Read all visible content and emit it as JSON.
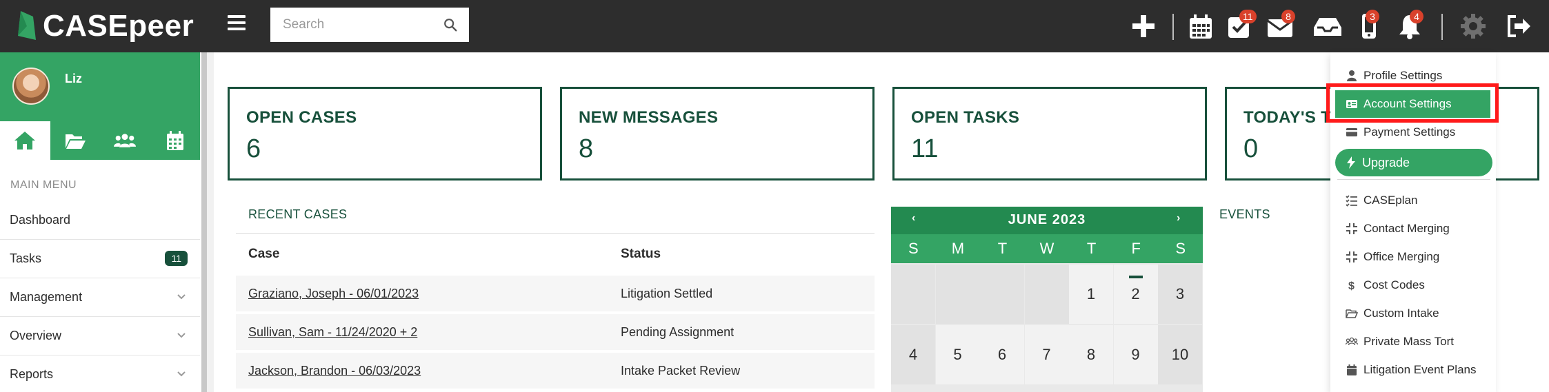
{
  "brand": {
    "name": "CASEpeer"
  },
  "search": {
    "placeholder": "Search"
  },
  "topbar": {
    "badges": {
      "tasks": "11",
      "messages": "8",
      "phone": "3",
      "notifications": "4"
    }
  },
  "user": {
    "name": "Liz"
  },
  "sidebar": {
    "menu_heading": "MAIN MENU",
    "items": [
      {
        "label": "Dashboard"
      },
      {
        "label": "Tasks",
        "count": "11"
      },
      {
        "label": "Management"
      },
      {
        "label": "Overview"
      },
      {
        "label": "Reports"
      }
    ]
  },
  "stats": [
    {
      "title": "OPEN CASES",
      "value": "6"
    },
    {
      "title": "NEW MESSAGES",
      "value": "8"
    },
    {
      "title": "OPEN TASKS",
      "value": "11"
    },
    {
      "title": "TODAY'S T",
      "value": "0"
    }
  ],
  "recent_cases": {
    "title": "RECENT CASES",
    "col_case": "Case",
    "col_status": "Status",
    "rows": [
      {
        "case": "Graziano, Joseph - 06/01/2023",
        "status": "Litigation Settled"
      },
      {
        "case": "Sullivan, Sam - 11/24/2020 + 2",
        "status": "Pending Assignment"
      },
      {
        "case": "Jackson, Brandon - 06/03/2023",
        "status": "Intake Packet Review"
      }
    ]
  },
  "calendar": {
    "title": "JUNE 2023",
    "prev": "‹",
    "next": "›",
    "dows": [
      "S",
      "M",
      "T",
      "W",
      "T",
      "F",
      "S"
    ],
    "week1": [
      "",
      "",
      "",
      "",
      "1",
      "2",
      "3"
    ],
    "week2": [
      "4",
      "5",
      "6",
      "7",
      "8",
      "9",
      "10"
    ]
  },
  "events": {
    "title": "EVENTS"
  },
  "dropdown": {
    "profile": "Profile Settings",
    "account": "Account Settings",
    "payment": "Payment Settings",
    "upgrade": "Upgrade",
    "caseplan": "CASEplan",
    "contact_merging": "Contact Merging",
    "office_merging": "Office Merging",
    "cost_codes": "Cost Codes",
    "custom_intake": "Custom Intake",
    "mass_tort": "Private Mass Tort",
    "event_plans": "Litigation Event Plans"
  },
  "colors": {
    "topbar": "#2d2d2d",
    "green": "#34a464",
    "dark_green": "#17503b",
    "badge": "#d9412b",
    "highlight": "#ff1a1a"
  }
}
